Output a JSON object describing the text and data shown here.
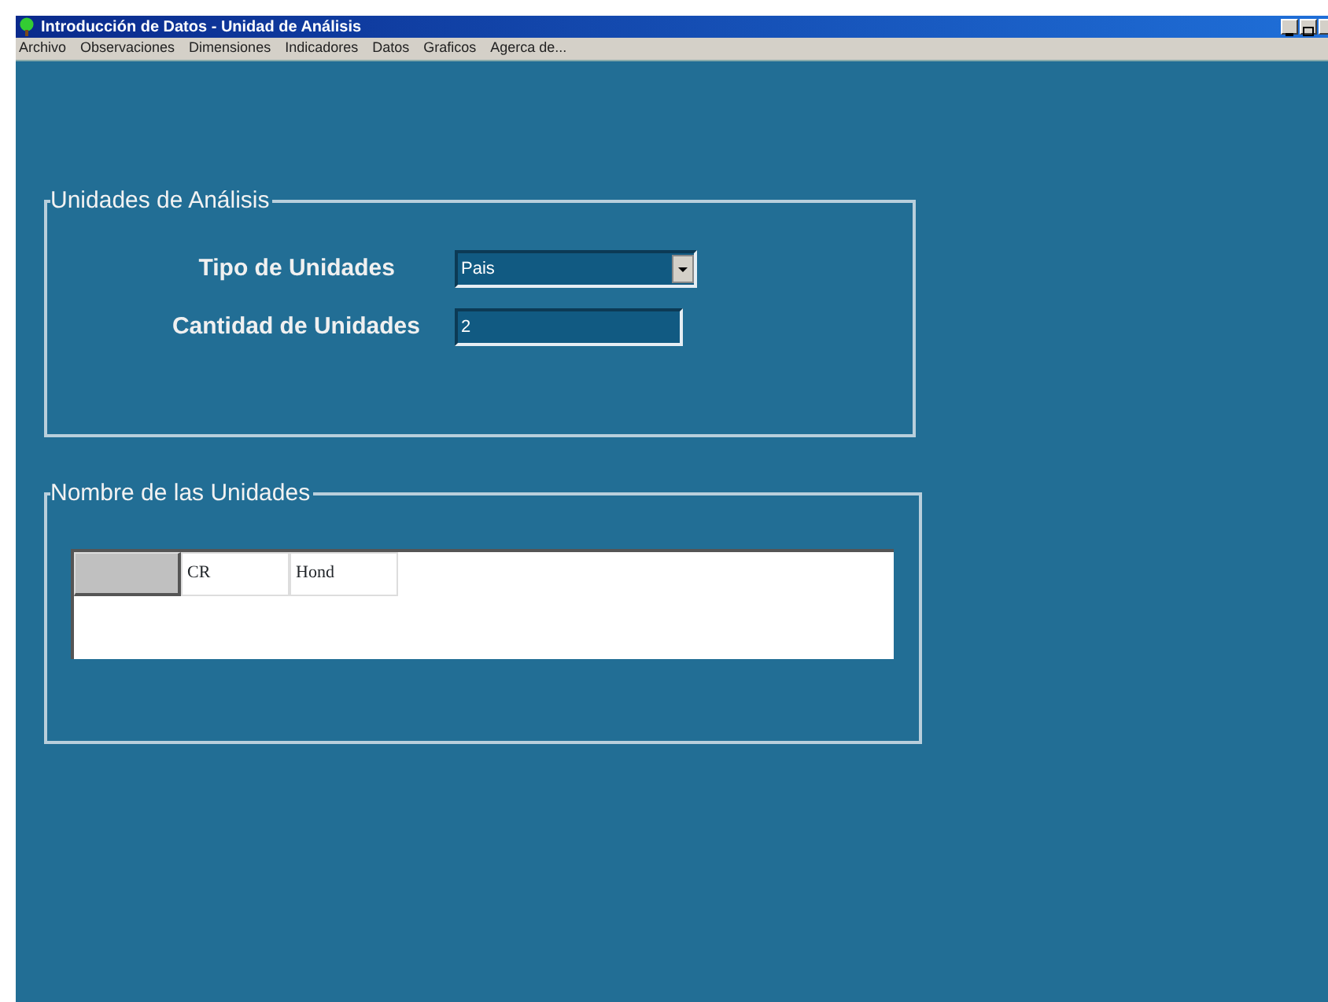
{
  "window": {
    "title": "Introducción de Datos - Unidad de Análisis"
  },
  "menu": [
    "Archivo",
    "Observaciones",
    "Dimensiones",
    "Indicadores",
    "Datos",
    "Graficos",
    "Agerca de..."
  ],
  "units_group": {
    "legend": "Unidades de Análisis",
    "type_label": "Tipo de Unidades",
    "type_value": "Pais",
    "count_label": "Cantidad de Unidades",
    "count_value": "2"
  },
  "names_group": {
    "legend": "Nombre de las Unidades",
    "cells": [
      "CR",
      "Hond"
    ]
  }
}
